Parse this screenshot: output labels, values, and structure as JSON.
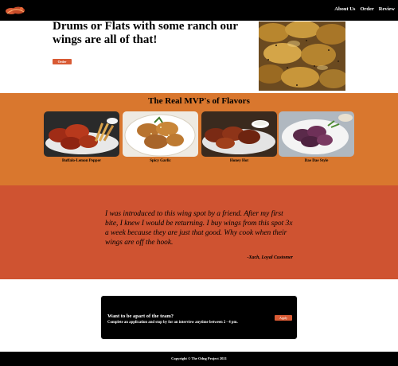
{
  "nav": {
    "logo_icon": "wings-logo-icon",
    "links": [
      {
        "label": "About Us"
      },
      {
        "label": "Order"
      },
      {
        "label": "Review"
      }
    ]
  },
  "hero": {
    "title": "Drums or Flats with some ranch our wings are all of that!",
    "order_label": "Order",
    "photo_icon": "chicken-wings-photo"
  },
  "flavors": {
    "title": "The Real MVP's of Flavors",
    "items": [
      {
        "name": "Buffalo-Lemon Pepper",
        "photo_icon": "buffalo-lemon-pepper-photo"
      },
      {
        "name": "Spicy Garlic",
        "photo_icon": "spicy-garlic-photo"
      },
      {
        "name": "Honey Hot",
        "photo_icon": "honey-hot-photo"
      },
      {
        "name": "Dae Dae Style",
        "photo_icon": "dae-dae-style-photo"
      }
    ]
  },
  "testimonial": {
    "quote": "I was introduced to this wing spot by a friend. After my first bite, I knew I would be returning. I buy wings from this spot 3x a week because they are just that good. Why cook when their wings are off the hook.",
    "author": "-Xach, Loyal Customer"
  },
  "careers": {
    "title": "Want to be apart of the team?",
    "text": "Complete an application and stop by for an interview anytime between 2 - 4 pm.",
    "apply_label": "Apply"
  },
  "footer": {
    "copyright": "Copyright © The Odng Project 2021"
  },
  "colors": {
    "nav_bg": "#000000",
    "flavors_bg": "#d9772e",
    "testimonial_bg": "#cf5331",
    "button": "#d85a34"
  }
}
